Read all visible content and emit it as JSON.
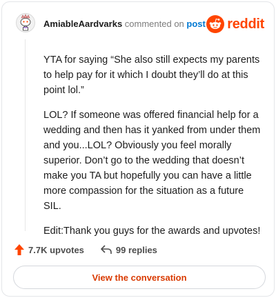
{
  "header": {
    "author": "AmiableAardvarks",
    "action_text": "commented on",
    "post_link": "post",
    "brand_word": "reddit"
  },
  "comment": {
    "paragraphs": [
      "YTA for saying “She also still expects my parents to help pay for it which I doubt they’ll do at this point lol.”",
      "LOL? If someone was offered financial help for a wedding and then has it yanked from under them and you...LOL? Obviously you feel morally superior. Don’t go to the wedding that doesn’t make you TA but hopefully you can have a little more compassion for the situation as a future SIL.",
      "Edit:Thank you guys for the awards and upvotes!"
    ]
  },
  "actions": {
    "upvotes": "7.7K upvotes",
    "replies": "99 replies"
  },
  "cta": {
    "label": "View the conversation"
  },
  "icons": {
    "avatar": "snoo-avatar-icon",
    "brand": "reddit-logo-icon",
    "upvote": "upvote-arrow-icon",
    "reply": "reply-arrow-icon"
  },
  "colors": {
    "brand": "#ff4500",
    "link": "#0079d3",
    "cta_text": "#d93a00",
    "border": "#e3e5e8"
  }
}
